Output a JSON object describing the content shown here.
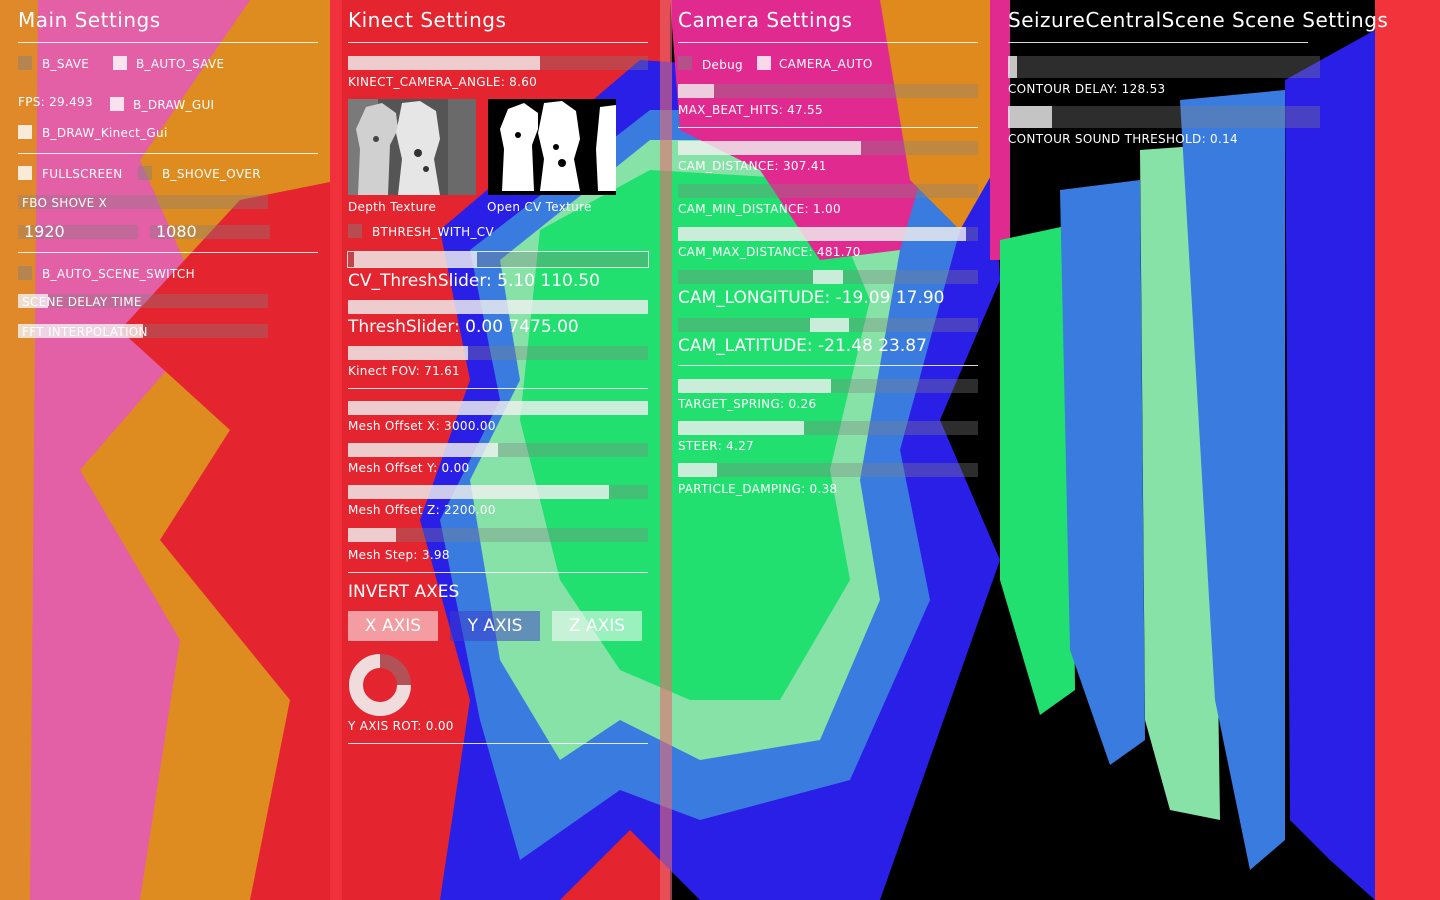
{
  "main": {
    "title": "Main Settings",
    "b_save": "B_SAVE",
    "b_auto_save": "B_AUTO_SAVE",
    "fps": "FPS: 29.493",
    "b_draw_gui": "B_DRAW_GUI",
    "b_draw_kinect_gui": "B_DRAW_Kinect_Gui",
    "fullscreen": "FULLSCREEN",
    "b_shove_over": "B_SHOVE_OVER",
    "fbo_shove_x": "FBO SHOVE X",
    "width_value": "1920",
    "height_value": "1080",
    "b_auto_scene_switch": "B_AUTO_SCENE_SWITCH",
    "scene_delay_time": "SCENE DELAY TIME",
    "scene_delay_level": 0.12,
    "fft_interpolation": "FFT INTERPOLATION",
    "fft_interpolation_level": 0.5
  },
  "kinect": {
    "title": "Kinect Settings",
    "camera_angle_label": "KINECT_CAMERA_ANGLE: 8.60",
    "camera_angle_level": 0.64,
    "depth_texture_label": "Depth Texture",
    "cv_texture_label": "Open CV Texture",
    "bthresh_with_cv": "BTHRESH_WITH_CV",
    "cv_thresh_slider": "CV_ThreshSlider:  5.10  110.50",
    "cv_thresh_range": [
      0.02,
      0.43
    ],
    "thresh_slider": "ThreshSlider:  0.00  7475.00",
    "thresh_range": [
      0.0,
      1.0
    ],
    "kinect_fov_label": "Kinect FOV: 71.61",
    "kinect_fov_level": 0.4,
    "mesh_offset_x_label": "Mesh Offset X: 3000.00",
    "mesh_offset_x_level": 1.0,
    "mesh_offset_y_label": "Mesh Offset Y: 0.00",
    "mesh_offset_y_level": 0.5,
    "mesh_offset_z_label": "Mesh Offset Z: 2200.00",
    "mesh_offset_z_level": 0.87,
    "mesh_step_label": "Mesh Step: 3.98",
    "mesh_step_level": 0.16,
    "invert_axes_label": "INVERT AXES",
    "x_axis": "X AXIS",
    "y_axis": "Y AXIS",
    "z_axis": "Z AXIS",
    "y_axis_rot_label": "Y AXIS ROT: 0.00"
  },
  "camera": {
    "title": "Camera Settings",
    "debug": "Debug",
    "camera_auto": "CAMERA_AUTO",
    "max_beat_hits_label": "MAX_BEAT_HITS: 47.55",
    "max_beat_hits_level": 0.12,
    "cam_distance_label": "CAM_DISTANCE: 307.41",
    "cam_distance_level": 0.61,
    "cam_min_distance_label": "CAM_MIN_DISTANCE: 1.00",
    "cam_min_distance_level": 0.0,
    "cam_max_distance_label": "CAM_MAX_DISTANCE: 481.70",
    "cam_max_distance_level": 0.96,
    "cam_longitude_label": "CAM_LONGITUDE:  -19.09  17.90",
    "cam_longitude_range": [
      0.45,
      0.55
    ],
    "cam_latitude_label": "CAM_LATITUDE:  -21.48  23.87",
    "cam_latitude_range": [
      0.44,
      0.57
    ],
    "target_spring_label": "TARGET_SPRING: 0.26",
    "target_spring_level": 0.51,
    "steer_label": "STEER: 4.27",
    "steer_level": 0.42,
    "particle_damping_label": "PARTICLE_DAMPING: 0.38",
    "particle_damping_level": 0.13
  },
  "scene": {
    "title": "SeizureCentralScene Scene Settings",
    "contour_delay_label": "CONTOUR DELAY: 128.53",
    "contour_delay_level": 0.03,
    "contour_sound_threshold_label": "CONTOUR SOUND THRESHOLD: 0.14",
    "contour_sound_threshold_level": 0.14
  },
  "colors": {
    "red": "#e8212e",
    "pink": "#e85fa8",
    "orange": "#e08a1e",
    "magenta": "#e02a90",
    "blue": "#2a1fe6",
    "mid_blue": "#3a7ae0",
    "light_blue": "#5a8ee0",
    "green": "#22e070",
    "mint": "#86e2a6",
    "panel_fill": "#ffffff"
  }
}
